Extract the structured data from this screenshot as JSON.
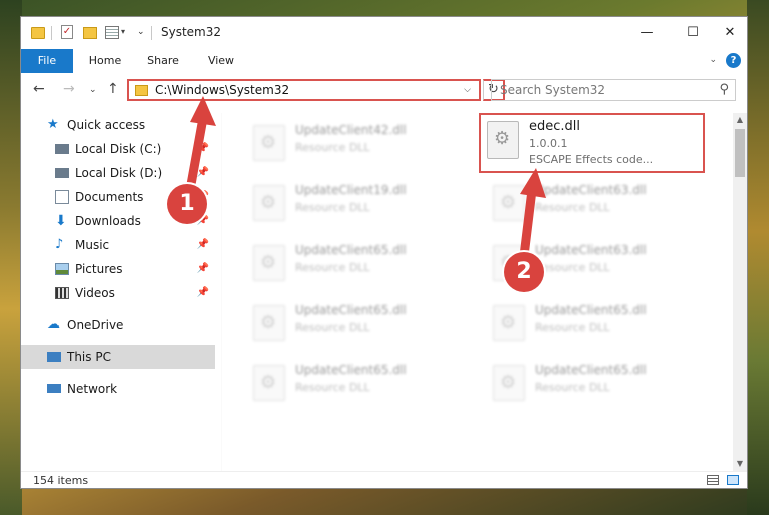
{
  "window": {
    "title": "System32"
  },
  "ribbon": {
    "tabs": [
      "File",
      "Home",
      "Share",
      "View"
    ],
    "help": "?"
  },
  "window_controls": {
    "minimize": "—",
    "maximize": "☐",
    "close": "✕"
  },
  "address": {
    "path": "C:\\Windows\\System32",
    "refresh": "↻",
    "dropdown": "⌵"
  },
  "search": {
    "placeholder": "Search System32",
    "icon": "⚲"
  },
  "nav": {
    "back": "←",
    "forward": "→",
    "recent": "⌄",
    "up": "↑"
  },
  "navpane": {
    "quick_access": "Quick access",
    "items": [
      {
        "label": "Local Disk (C:)",
        "pinned": true
      },
      {
        "label": "Local Disk (D:)",
        "pinned": true
      },
      {
        "label": "Documents",
        "pinned": true
      },
      {
        "label": "Downloads",
        "pinned": true
      },
      {
        "label": "Music",
        "pinned": true
      },
      {
        "label": "Pictures",
        "pinned": true
      },
      {
        "label": "Videos",
        "pinned": true
      }
    ],
    "onedrive": "OneDrive",
    "this_pc": "This PC",
    "network": "Network"
  },
  "files": {
    "highlighted": {
      "name": "edec.dll",
      "version": "1.0.0.1",
      "description": "ESCAPE Effects code..."
    },
    "tiles": [
      {
        "name": "UpdateClient42.dll",
        "desc": "Resource DLL"
      },
      {
        "name": "UpdateClient19.dll",
        "desc": "Resource DLL"
      },
      {
        "name": "UpdateClient63.dll",
        "desc": "Resource DLL"
      },
      {
        "name": "UpdateClient65.dll",
        "desc": "Resource DLL"
      },
      {
        "name": "UpdateClient63.dll",
        "desc": "Resource DLL"
      },
      {
        "name": "UpdateClient65.dll",
        "desc": "Resource DLL"
      },
      {
        "name": "UpdateClient65.dll",
        "desc": "Resource DLL"
      },
      {
        "name": "UpdateClient65.dll",
        "desc": "Resource DLL"
      },
      {
        "name": "UpdateClient65.dll",
        "desc": "Resource DLL"
      }
    ]
  },
  "status": {
    "items": "154 items"
  },
  "annotations": {
    "step1": "1",
    "step2": "2",
    "color": "#d9433e"
  }
}
